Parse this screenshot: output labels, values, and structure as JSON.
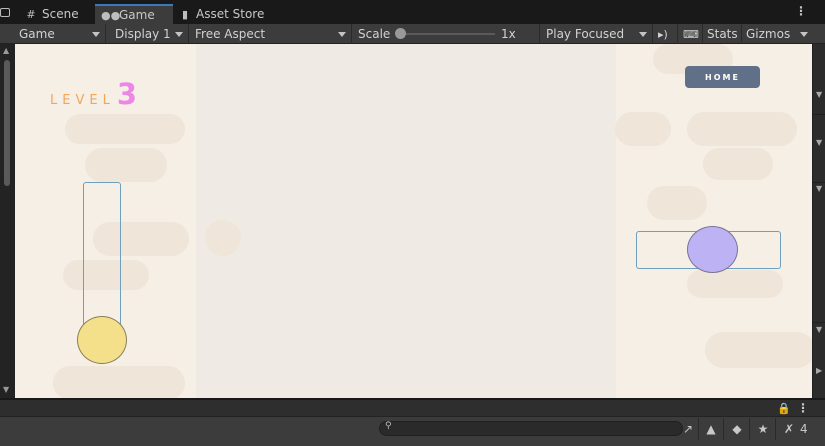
{
  "tabs": [
    {
      "label": "Scene",
      "icon": "grid-icon"
    },
    {
      "label": "Game",
      "icon": "gamepad-icon"
    },
    {
      "label": "Asset Store",
      "icon": "bag-icon"
    }
  ],
  "toolbar": {
    "view_select": "Game",
    "display_select": "Display 1",
    "aspect_select": "Free Aspect",
    "scale_label": "Scale",
    "scale_value": "1x",
    "play_mode": "Play Focused",
    "stats_label": "Stats",
    "gizmos_label": "Gizmos"
  },
  "game": {
    "level_word": "LEVEL",
    "level_number": "3",
    "home_button": "HOME",
    "colors": {
      "background": "#f5efe6",
      "level_word": "#f2a65a",
      "level_number": "#ee86e8",
      "home_button": "#5f7088",
      "ball_yellow": "#f4e08a",
      "ball_purple": "#bdb3f4",
      "track_outline": "#6f9fbf"
    }
  },
  "bottom": {
    "search_placeholder": "",
    "hidden_count": "4"
  }
}
